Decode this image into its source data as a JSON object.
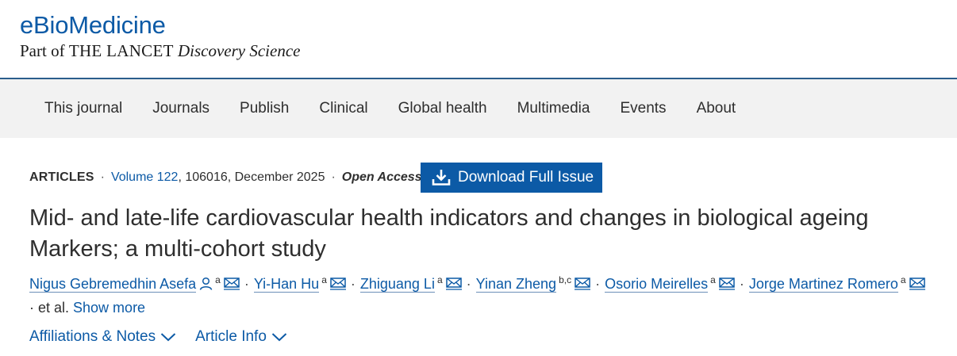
{
  "brand": {
    "title": "eBioMedicine",
    "sub_prefix": "Part of ",
    "sub_lancet": "THE LANCET",
    "sub_ds": " Discovery Science"
  },
  "nav": {
    "items": [
      "This journal",
      "Journals",
      "Publish",
      "Clinical",
      "Global health",
      "Multimedia",
      "Events",
      "About"
    ]
  },
  "meta": {
    "type": "ARTICLES",
    "sep": "·",
    "volume": "Volume 122",
    "details": ", 106016, December 2025",
    "access": "Open Access"
  },
  "download": {
    "label": "Download Full Issue",
    "icon": "download-icon"
  },
  "article": {
    "title": "Mid- and late-life cardiovascular health indicators and changes in biological ageing Markers; a multi-cohort study"
  },
  "authors": [
    {
      "name": "Nigus Gebremedhin Asefa",
      "sup": "a",
      "person_icon": true
    },
    {
      "name": "Yi-Han Hu",
      "sup": "a"
    },
    {
      "name": "Zhiguang Li",
      "sup": "a"
    },
    {
      "name": "Yinan Zheng",
      "sup": "b,c"
    },
    {
      "name": "Osorio Meirelles",
      "sup": "a"
    },
    {
      "name": "Jorge Martinez Romero",
      "sup": "a"
    }
  ],
  "authors_tail": {
    "et_al": " · et al. ",
    "show_more": "Show more"
  },
  "links": {
    "affiliations": "Affiliations & Notes",
    "article_info": "Article Info"
  },
  "colors": {
    "accent": "#0c5aa6",
    "nav_bg": "#f2f2f2",
    "text": "#2e2e2e"
  }
}
